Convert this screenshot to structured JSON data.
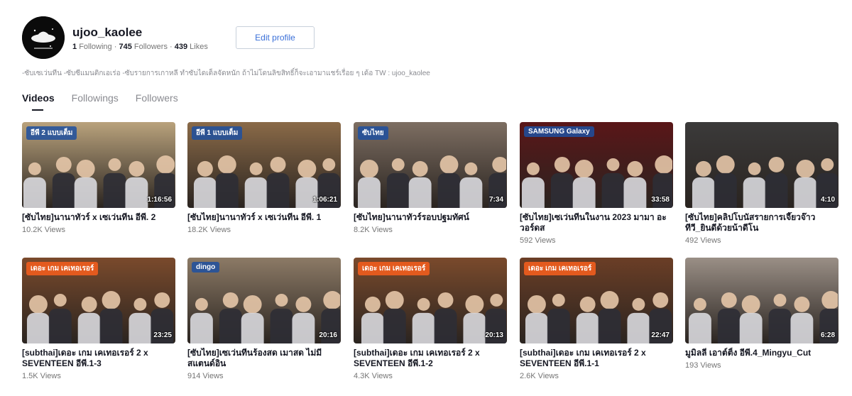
{
  "profile": {
    "username": "ujoo_kaolee",
    "following_count": "1",
    "following_label": "Following",
    "followers_count": "745",
    "followers_label": "Followers",
    "likes_count": "439",
    "likes_label": "Likes",
    "edit_button": "Edit profile",
    "bio": "-ซับเซเว่นทีน -ซับซีแมนติกเอเร่อ -ซับรายการเกาหลี ทำซับไดเต็ลจัดหนัก ถ้าไม่โดนลิขสิทธิ์ก็จะเอามาแชร์เรื่อย ๆ เด้อ TW : ujoo_kaolee"
  },
  "tabs": [
    {
      "label": "Videos",
      "active": true
    },
    {
      "label": "Followings",
      "active": false
    },
    {
      "label": "Followers",
      "active": false
    }
  ],
  "videos": [
    {
      "title": "[ซับไทย]นานาทัวร์ x เซเว่นทีน อีพี. 2",
      "views": "10.2K Views",
      "duration": "1:16:56",
      "overlay": "อีพี 2 แบบเต็ม",
      "bg": "#b9a27c"
    },
    {
      "title": "[ซับไทย]นานาทัวร์ x เซเว่นทีน อีพี. 1",
      "views": "18.2K Views",
      "duration": "1:06:21",
      "overlay": "อีพี 1 แบบเต็ม",
      "bg": "#8a6a48"
    },
    {
      "title": "[ซับไทย]นานาทัวร์รอบปฐมทัศน์",
      "views": "8.2K Views",
      "duration": "7:34",
      "overlay": "ซับไทย",
      "bg": "#7d6e62"
    },
    {
      "title": "[ซับไทย]เซเว่นทีนในงาน 2023 มามา อะวอร์ดส",
      "views": "592 Views",
      "duration": "33:58",
      "overlay": "SAMSUNG Galaxy",
      "bg": "#5a1618"
    },
    {
      "title": "[ซับไทย]คลิปโบนัสรายการเจี๊ยวจ๊าวทีวี_ยินดีด้วยน้าดีโน",
      "views": "492 Views",
      "duration": "4:10",
      "overlay": "",
      "bg": "#3b3a3a"
    },
    {
      "title": "[subthai]เดอะ เกม เคเทอเรอร์ 2 x SEVENTEEN อีพี.1-3",
      "views": "1.5K Views",
      "duration": "23:25",
      "overlay": "เดอะ เกม เคเทอเรอร์",
      "bg": "#7a4a2c"
    },
    {
      "title": "[ซับไทย]เซเว่นทีนร้องสด เมาสด ไม่มีสแตนด์อิน",
      "views": "914 Views",
      "duration": "20:16",
      "overlay": "dingo",
      "bg": "#8c7a66"
    },
    {
      "title": "[subthai]เดอะ เกม เคเทอเรอร์ 2 x SEVENTEEN อีพี.1-2",
      "views": "4.3K Views",
      "duration": "20:13",
      "overlay": "เดอะ เกม เคเทอเรอร์",
      "bg": "#7a4a2c"
    },
    {
      "title": "[subthai]เดอะ เกม เคเทอเรอร์ 2 x SEVENTEEN อีพี.1-1",
      "views": "2.6K Views",
      "duration": "22:47",
      "overlay": "เดอะ เกม เคเทอเรอร์",
      "bg": "#6b3e26"
    },
    {
      "title": "มูมิลลี่ เอาต์ติ้ง อีพี.4_Mingyu_Cut",
      "views": "193 Views",
      "duration": "6:28",
      "overlay": "",
      "bg": "#9a8f86"
    }
  ]
}
